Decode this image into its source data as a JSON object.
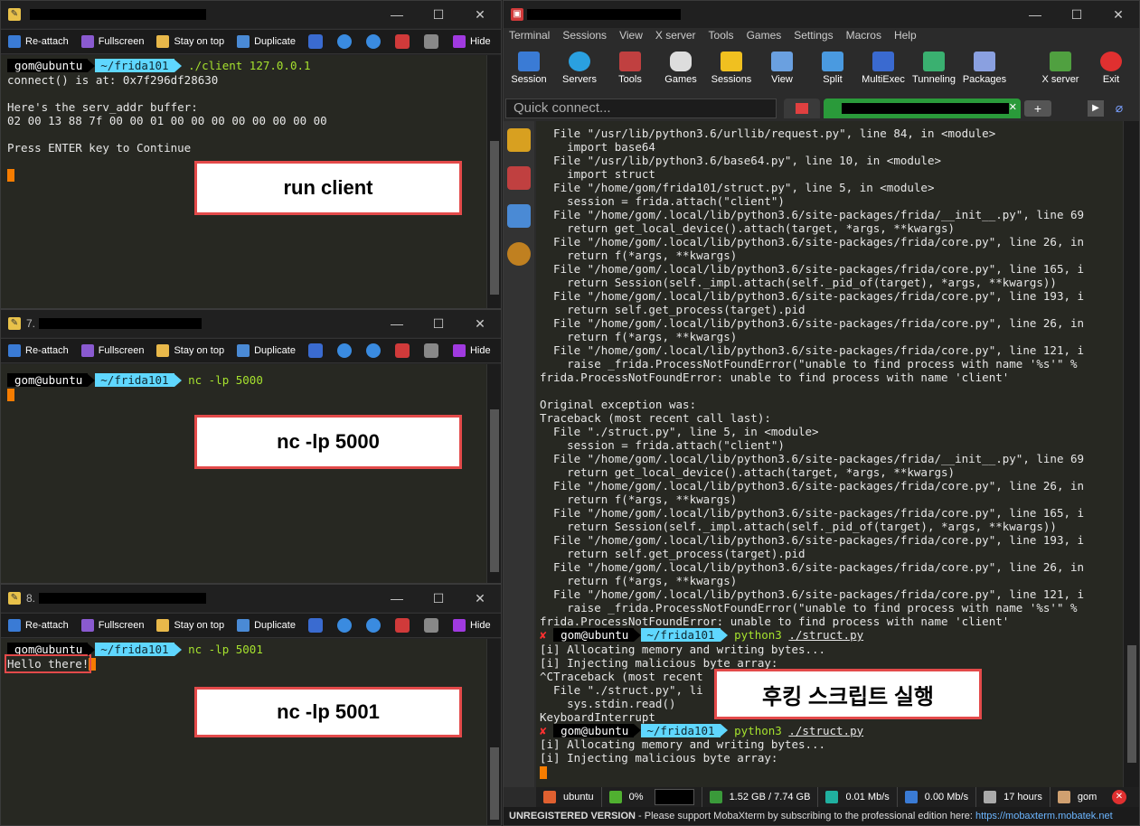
{
  "windows": [
    {
      "title_prefix": "",
      "toolbar": [
        "Re-attach",
        "Fullscreen",
        "Stay on top",
        "Duplicate",
        "Hide"
      ],
      "terminal": {
        "user": "gom@ubuntu",
        "dir": "~/frida101",
        "command": "./client 127.0.0.1",
        "lines": [
          "connect() is at: 0x7f296df28630",
          "",
          "Here's the serv_addr buffer:",
          "02 00 13 88 7f 00 00 01 00 00 00 00 00 00 00 00",
          "",
          "Press ENTER key to Continue"
        ]
      },
      "annotation": "run client"
    },
    {
      "title_prefix": "7.",
      "toolbar": [
        "Re-attach",
        "Fullscreen",
        "Stay on top",
        "Duplicate",
        "Hide"
      ],
      "terminal": {
        "user": "gom@ubuntu",
        "dir": "~/frida101",
        "command": "nc -lp 5000",
        "lines": []
      },
      "annotation": "nc -lp 5000"
    },
    {
      "title_prefix": "8.",
      "toolbar": [
        "Re-attach",
        "Fullscreen",
        "Stay on top",
        "Duplicate",
        "Hide"
      ],
      "terminal": {
        "user": "gom@ubuntu",
        "dir": "~/frida101",
        "command": "nc -lp 5001",
        "lines": [
          "Hello there!"
        ]
      },
      "annotation": "nc -lp 5001"
    }
  ],
  "window_controls": [
    "—",
    "☐",
    "✕"
  ],
  "mobaxterm": {
    "menu": [
      "Terminal",
      "Sessions",
      "View",
      "X server",
      "Tools",
      "Games",
      "Settings",
      "Macros",
      "Help"
    ],
    "ribbon": [
      "Session",
      "Servers",
      "Tools",
      "Games",
      "Sessions",
      "View",
      "Split",
      "MultiExec",
      "Tunneling",
      "Packages",
      "X server",
      "Exit"
    ],
    "quick_connect_placeholder": "Quick connect...",
    "terminal_lines": [
      "  File \"/usr/lib/python3.6/urllib/request.py\", line 84, in <module>",
      "    import base64",
      "  File \"/usr/lib/python3.6/base64.py\", line 10, in <module>",
      "    import struct",
      "  File \"/home/gom/frida101/struct.py\", line 5, in <module>",
      "    session = frida.attach(\"client\")",
      "  File \"/home/gom/.local/lib/python3.6/site-packages/frida/__init__.py\", line 69",
      "    return get_local_device().attach(target, *args, **kwargs)",
      "  File \"/home/gom/.local/lib/python3.6/site-packages/frida/core.py\", line 26, in",
      "    return f(*args, **kwargs)",
      "  File \"/home/gom/.local/lib/python3.6/site-packages/frida/core.py\", line 165, i",
      "    return Session(self._impl.attach(self._pid_of(target), *args, **kwargs))",
      "  File \"/home/gom/.local/lib/python3.6/site-packages/frida/core.py\", line 193, i",
      "    return self.get_process(target).pid",
      "  File \"/home/gom/.local/lib/python3.6/site-packages/frida/core.py\", line 26, in",
      "    return f(*args, **kwargs)",
      "  File \"/home/gom/.local/lib/python3.6/site-packages/frida/core.py\", line 121, i",
      "    raise _frida.ProcessNotFoundError(\"unable to find process with name '%s'\" %",
      "frida.ProcessNotFoundError: unable to find process with name 'client'",
      "",
      "Original exception was:",
      "Traceback (most recent call last):",
      "  File \"./struct.py\", line 5, in <module>",
      "    session = frida.attach(\"client\")",
      "  File \"/home/gom/.local/lib/python3.6/site-packages/frida/__init__.py\", line 69",
      "    return get_local_device().attach(target, *args, **kwargs)",
      "  File \"/home/gom/.local/lib/python3.6/site-packages/frida/core.py\", line 26, in",
      "    return f(*args, **kwargs)",
      "  File \"/home/gom/.local/lib/python3.6/site-packages/frida/core.py\", line 165, i",
      "    return Session(self._impl.attach(self._pid_of(target), *args, **kwargs))",
      "  File \"/home/gom/.local/lib/python3.6/site-packages/frida/core.py\", line 193, i",
      "    return self.get_process(target).pid",
      "  File \"/home/gom/.local/lib/python3.6/site-packages/frida/core.py\", line 26, in",
      "    return f(*args, **kwargs)",
      "  File \"/home/gom/.local/lib/python3.6/site-packages/frida/core.py\", line 121, i",
      "    raise _frida.ProcessNotFoundError(\"unable to find process with name '%s'\" %",
      "frida.ProcessNotFoundError: unable to find process with name 'client'"
    ],
    "session1": {
      "user": "gom@ubuntu",
      "dir": "~/frida101",
      "command": "python3",
      "arg": "./struct.py",
      "lines": [
        "[i] Allocating memory and writing bytes...",
        "[i] Injecting malicious byte array:",
        "^CTraceback (most recent",
        "  File \"./struct.py\", li",
        "    sys.stdin.read()",
        "KeyboardInterrupt"
      ]
    },
    "session2": {
      "user": "gom@ubuntu",
      "dir": "~/frida101",
      "command": "python3",
      "arg": "./struct.py",
      "lines": [
        "[i] Allocating memory and writing bytes...",
        "[i] Injecting malicious byte array:"
      ]
    },
    "annotation": "후킹 스크립트 실행",
    "status": {
      "host": "ubuntu",
      "cpu": "0%",
      "memory": "1.52 GB / 7.74 GB",
      "upload": "0.01 Mb/s",
      "download": "0.00 Mb/s",
      "uptime": "17 hours",
      "user": "gom"
    },
    "unregistered_prefix": "UNREGISTERED VERSION",
    "unregistered_text": " - Please support MobaXterm by subscribing to the professional edition here: ",
    "unregistered_link": "https://mobaxterm.mobatek.net"
  },
  "colors": {
    "prompt_dir_bg": "#5fd7ff",
    "command": "#a6e22e",
    "cursor": "#f57c00",
    "annotation_border": "#e34a4a"
  }
}
